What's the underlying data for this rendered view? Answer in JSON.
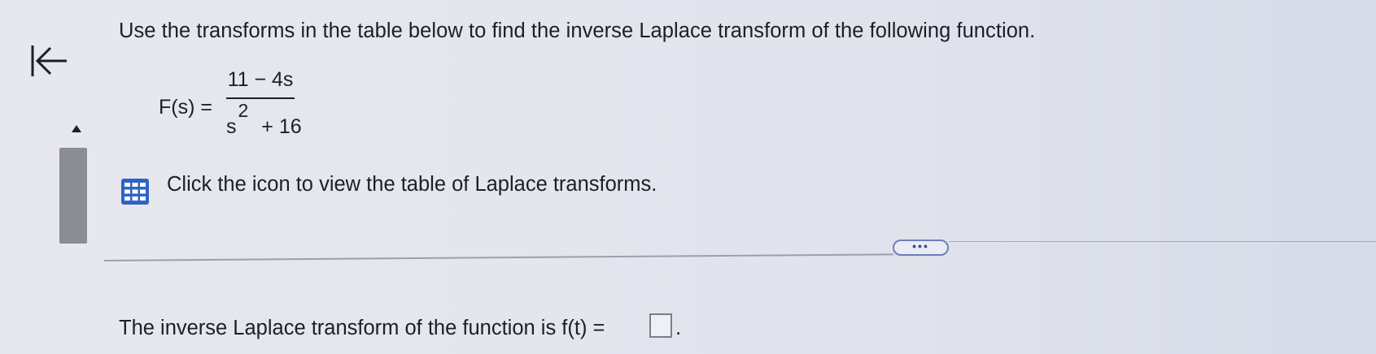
{
  "question": {
    "prompt": "Use the transforms in the table below to find the inverse Laplace transform of the following function."
  },
  "formula": {
    "lhs": "F(s) =",
    "numerator": "11 − 4s",
    "denominator_base": "s",
    "denominator_exponent": "2",
    "denominator_rest": "+ 16"
  },
  "table_link": {
    "text": "Click the icon to view the table of Laplace transforms."
  },
  "more_button": {
    "label": "•••"
  },
  "answer": {
    "prompt": "The inverse Laplace transform of the function is f(t) =",
    "value": "",
    "suffix": "."
  },
  "icons": {
    "back": "back-to-start-icon",
    "scroll_up": "triangle-up-icon",
    "table": "table-grid-icon"
  },
  "colors": {
    "text": "#1d1f25",
    "icon_blue": "#2f63c8",
    "scroll_thumb": "#8b8d93",
    "more_border": "#6e7fb8"
  }
}
